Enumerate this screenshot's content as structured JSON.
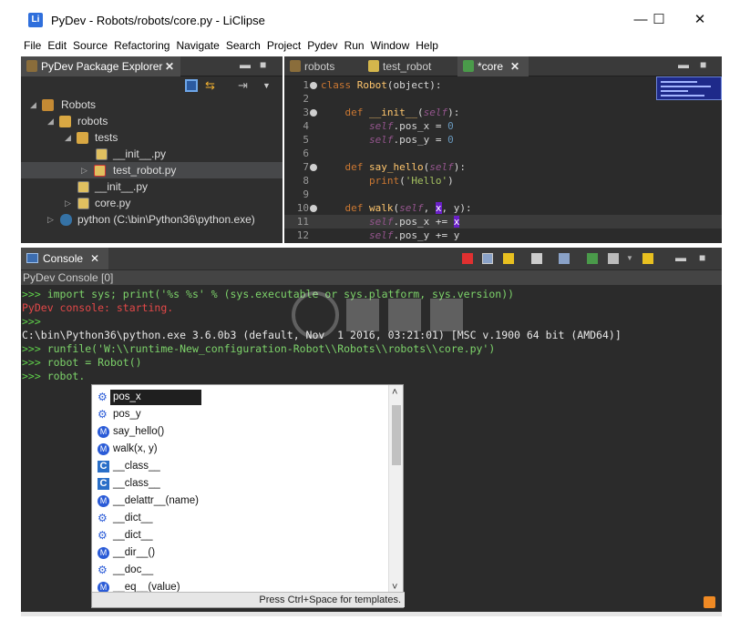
{
  "window": {
    "app_icon": "Li",
    "title": "PyDev - Robots/robots/core.py - LiClipse",
    "minimize": "—",
    "maximize": "☐",
    "close": "✕"
  },
  "menu": [
    "File",
    "Edit",
    "Source",
    "Refactoring",
    "Navigate",
    "Search",
    "Project",
    "Pydev",
    "Run",
    "Window",
    "Help"
  ],
  "explorer": {
    "tab_label": "PyDev Package Explorer",
    "tree": [
      {
        "label": "Robots",
        "icon": "project-error-icon"
      },
      {
        "label": "robots",
        "icon": "package-error-icon"
      },
      {
        "label": "tests",
        "icon": "package-error-icon"
      },
      {
        "label": "__init__.py",
        "icon": "python-file-icon"
      },
      {
        "label": "test_robot.py",
        "icon": "python-file-error-icon"
      },
      {
        "label": "__init__.py",
        "icon": "python-file-icon"
      },
      {
        "label": "core.py",
        "icon": "python-file-icon"
      },
      {
        "label": "python  (C:\\bin\\Python36\\python.exe)",
        "icon": "python-interpreter-icon"
      }
    ]
  },
  "editor": {
    "tabs": [
      {
        "label": "robots",
        "active": false
      },
      {
        "label": "test_robot",
        "active": false
      },
      {
        "label": "*core",
        "active": true
      }
    ],
    "lines": [
      "1",
      "2",
      "3",
      "4",
      "5",
      "6",
      "7",
      "8",
      "9",
      "10",
      "11",
      "12"
    ]
  },
  "console": {
    "tab_label": "Console",
    "subheader": "PyDev Console [0]",
    "lines": {
      "l1_prompt": ">>>",
      "l1_text": " import sys; print('%s %s' % (sys.executable or sys.platform, sys.version))",
      "l2": "PyDev console: starting.",
      "l3": ">>>",
      "l4": "C:\\bin\\Python36\\python.exe 3.6.0b3 (default, Nov  1 2016, 03:21:01) [MSC v.1900 64 bit (AMD64)]",
      "l5_prompt": ">>>",
      "l5_text": " runfile('W:\\\\runtime-New_configuration-Robot\\\\Robots\\\\robots\\\\core.py')",
      "l6_prompt": ">>>",
      "l6_text": " robot = Robot()",
      "l7_prompt": ">>>",
      "l7_text": " robot."
    }
  },
  "autocomplete": {
    "items": [
      {
        "label": "pos_x",
        "icon": "field-icon"
      },
      {
        "label": "pos_y",
        "icon": "field-icon"
      },
      {
        "label": "say_hello()",
        "icon": "method-icon"
      },
      {
        "label": "walk(x, y)",
        "icon": "method-icon"
      },
      {
        "label": "__class__",
        "icon": "class-icon"
      },
      {
        "label": "__class__",
        "icon": "class-icon"
      },
      {
        "label": "__delattr__(name)",
        "icon": "method-icon"
      },
      {
        "label": "__dict__",
        "icon": "field-icon"
      },
      {
        "label": "__dict__",
        "icon": "field-icon"
      },
      {
        "label": "__dir__()",
        "icon": "method-icon"
      },
      {
        "label": "__doc__",
        "icon": "field-icon"
      },
      {
        "label": "__eq__(value)",
        "icon": "method-icon"
      }
    ],
    "footer": "Press Ctrl+Space for templates.",
    "scroll_up": "˄",
    "scroll_down": "˅"
  },
  "colors": {
    "keyword": "#cc7832",
    "class_name": "#ffc66d",
    "self": "#94558d",
    "number": "#6897bb",
    "string": "#a5c261",
    "prompt": "#5fd14a",
    "error": "#e34848"
  }
}
